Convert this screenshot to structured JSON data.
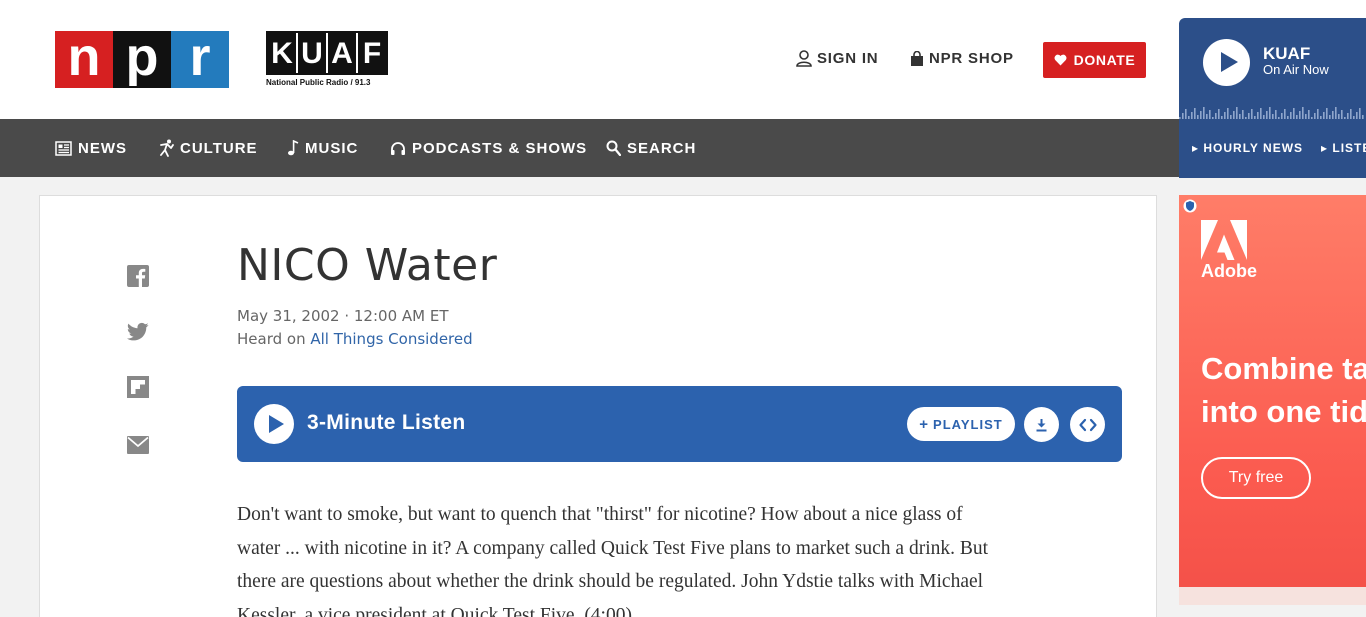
{
  "header": {
    "logo": {
      "letters": [
        "n",
        "p",
        "r"
      ]
    },
    "station_logo": {
      "letters": [
        "K",
        "U",
        "A",
        "F"
      ],
      "tagline": "National Public Radio / 91.3"
    },
    "sign_in": "SIGN IN",
    "shop": "NPR SHOP",
    "donate": "DONATE"
  },
  "nav": {
    "items": [
      {
        "label": "NEWS",
        "icon": "newspaper-icon"
      },
      {
        "label": "CULTURE",
        "icon": "culture-icon"
      },
      {
        "label": "MUSIC",
        "icon": "music-note-icon"
      },
      {
        "label": "PODCASTS & SHOWS",
        "icon": "headphones-icon"
      },
      {
        "label": "SEARCH",
        "icon": "search-icon"
      }
    ]
  },
  "station": {
    "name": "KUAF",
    "status": "On Air Now",
    "links": [
      "HOURLY NEWS",
      "LISTE"
    ]
  },
  "article": {
    "title": "NICO Water",
    "date": "May 31, 2002 · 12:00 AM ET",
    "heard_prefix": "Heard on ",
    "program": "All Things Considered",
    "share_icons": [
      "facebook-icon",
      "twitter-icon",
      "flipboard-icon",
      "email-icon"
    ],
    "player": {
      "label": "3-Minute Listen",
      "playlist": "PLAYLIST"
    },
    "body": "Don't want to smoke, but want to quench that \"thirst\" for nicotine? How about a nice glass of water ... with nicotine in it? A company called Quick Test Five plans to market such a drink. But there are questions about whether the drink should be regulated. John Ydstie talks with Michael Kessler, a vice president at Quick Test Five. (4:00)"
  },
  "ad": {
    "brand": "Adobe",
    "headline_line1": "Combine ta",
    "headline_line2": "into one tid",
    "cta": "Try free"
  },
  "colors": {
    "npr_red": "#d62021",
    "npr_blue": "#237bbd",
    "nav_bg": "#4a4a4a",
    "player_blue": "#2c62ae",
    "station_blue": "#2c4f89",
    "link_blue": "#3165a8"
  }
}
